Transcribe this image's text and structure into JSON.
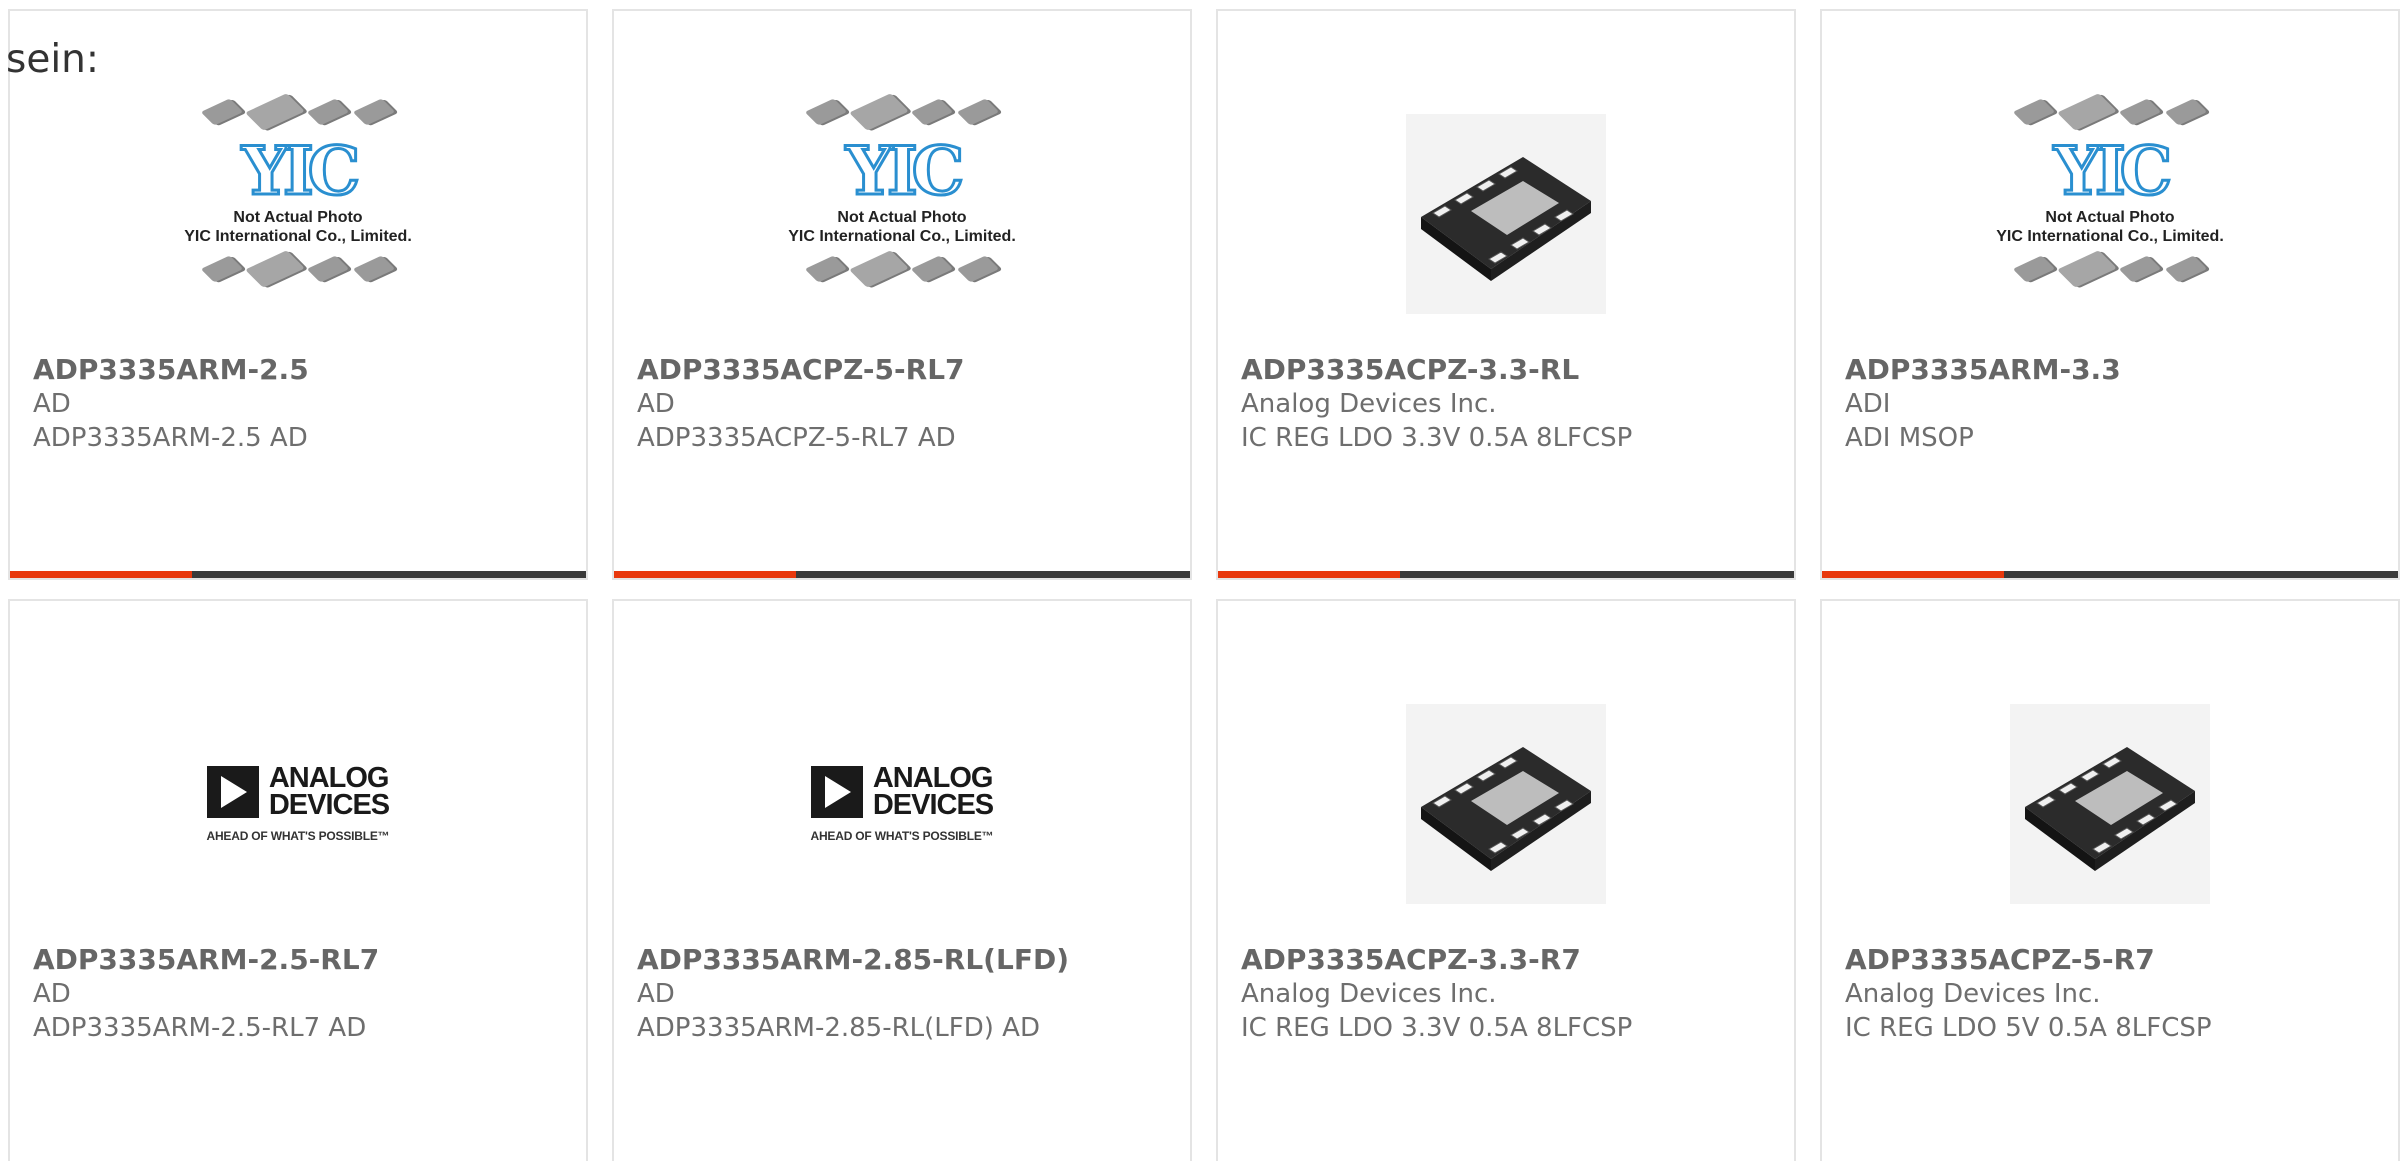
{
  "lead_text": "sein:",
  "image_labels": {
    "yic_logo": "YIC",
    "yic_caption_line1": "Not Actual Photo",
    "yic_caption_line2": "YIC International Co., Limited.",
    "adi_logo_line1": "ANALOG",
    "adi_logo_line2": "DEVICES",
    "adi_tagline": "AHEAD OF WHAT'S POSSIBLE™"
  },
  "colors": {
    "accent": "#e8380d",
    "bar": "#3a3a3a",
    "border": "#e4e4e4",
    "yic_blue": "#2a8fd0"
  },
  "products": [
    {
      "part": "ADP3335ARM-2.5",
      "manufacturer": "AD",
      "description": "ADP3335ARM-2.5 AD",
      "image": "yic-placeholder-icon"
    },
    {
      "part": "ADP3335ACPZ-5-RL7",
      "manufacturer": "AD",
      "description": "ADP3335ACPZ-5-RL7 AD",
      "image": "yic-placeholder-icon"
    },
    {
      "part": "ADP3335ACPZ-3.3-RL",
      "manufacturer": "Analog Devices Inc.",
      "description": "IC REG LDO 3.3V 0.5A 8LFCSP",
      "image": "qfn-chip-icon"
    },
    {
      "part": "ADP3335ARM-3.3",
      "manufacturer": "ADI",
      "description": "ADI MSOP",
      "image": "yic-placeholder-icon"
    },
    {
      "part": "ADP3335ARM-2.5-RL7",
      "manufacturer": "AD",
      "description": "ADP3335ARM-2.5-RL7 AD",
      "image": "analog-devices-logo"
    },
    {
      "part": "ADP3335ARM-2.85-RL(LFD)",
      "manufacturer": "AD",
      "description": "ADP3335ARM-2.85-RL(LFD) AD",
      "image": "analog-devices-logo"
    },
    {
      "part": "ADP3335ACPZ-3.3-R7",
      "manufacturer": "Analog Devices Inc.",
      "description": "IC REG LDO 3.3V 0.5A 8LFCSP",
      "image": "qfn-chip-icon"
    },
    {
      "part": "ADP3335ACPZ-5-R7",
      "manufacturer": "Analog Devices Inc.",
      "description": "IC REG LDO 5V 0.5A 8LFCSP",
      "image": "qfn-chip-icon"
    }
  ]
}
